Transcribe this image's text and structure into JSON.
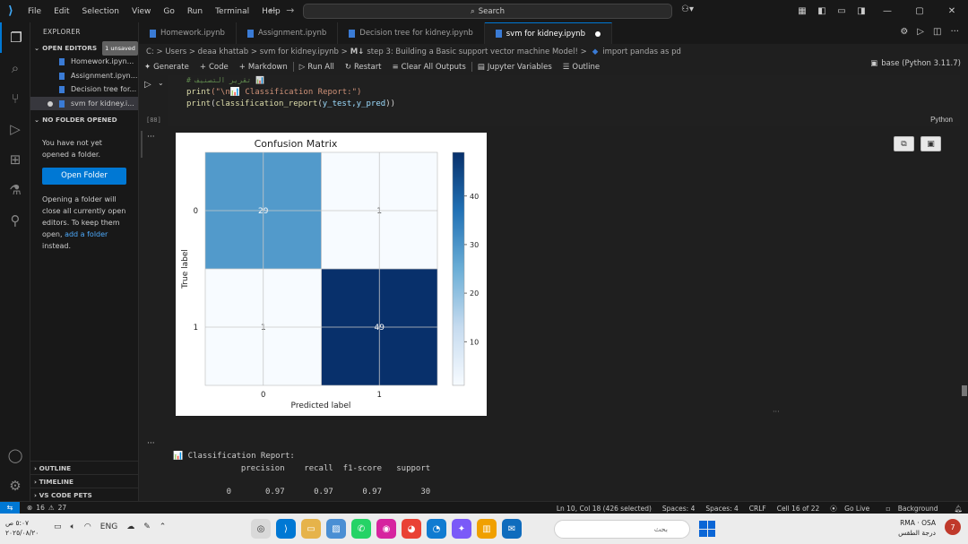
{
  "titlebar": {
    "menu": [
      "File",
      "Edit",
      "Selection",
      "View",
      "Go",
      "Run",
      "Terminal",
      "Help"
    ],
    "search_label": "Search"
  },
  "sidebar": {
    "title": "EXPLORER",
    "open_editors_label": "OPEN EDITORS",
    "unsaved_badge": "1 unsaved",
    "open_editors": [
      "Homework.ipyn...",
      "Assignment.ipyn...",
      "Decision tree for...",
      "svm for kidney.i..."
    ],
    "no_folder_label": "NO FOLDER OPENED",
    "no_folder_text": "You have not yet opened a folder.",
    "open_folder_button": "Open Folder",
    "close_text_1": "Opening a folder will close all currently open editors. To keep them open,",
    "add_folder_link": "add a folder",
    "close_text_2": "instead.",
    "bottom_sections": [
      "OUTLINE",
      "TIMELINE",
      "VS CODE PETS"
    ]
  },
  "tabs": [
    {
      "label": "Homework.ipynb",
      "active": false
    },
    {
      "label": "Assignment.ipynb",
      "active": false
    },
    {
      "label": "Decision tree for kidney.ipynb",
      "active": false
    },
    {
      "label": "svm for kidney.ipynb",
      "active": true
    }
  ],
  "breadcrumb": {
    "path": "C: > Users > deaa khattab > svm for kidney.ipynb >",
    "section": "step 3: Building a Basic support vector machine Model! >",
    "cell": "import pandas as pd"
  },
  "toolbar": {
    "generate": "Generate",
    "code": "Code",
    "markdown": "Markdown",
    "run_all": "Run All",
    "restart": "Restart",
    "clear_outputs": "Clear All Outputs",
    "jupyter_variables": "Jupyter Variables",
    "outline": "Outline",
    "kernel": "base (Python 3.11.7)"
  },
  "cell": {
    "code_comment": "# تقرير التصنيف 📊",
    "code_line_2_fn": "print",
    "code_line_2_str": "(\"\\n📊 Classification Report:\")",
    "code_line_3_fn": "print",
    "code_line_3_inner": "classification_report",
    "code_line_3_args": "y_test,y_pred",
    "exec_count": "[88]",
    "language": "Python"
  },
  "chart_data": {
    "type": "heatmap",
    "title": "Confusion Matrix",
    "xlabel": "Predicted label",
    "ylabel": "True label",
    "x_categories": [
      "0",
      "1"
    ],
    "y_categories": [
      "0",
      "1"
    ],
    "values": [
      [
        29,
        1
      ],
      [
        1,
        49
      ]
    ],
    "colorbar_ticks": [
      10,
      20,
      30,
      40
    ],
    "colorbar_range": [
      1,
      49
    ],
    "colormap": "Blues",
    "grid": true
  },
  "report": {
    "header": "📊 Classification Report:",
    "columns": "              precision    recall  f1-score   support",
    "row0": "           0       0.97      0.97      0.97        30"
  },
  "statusbar": {
    "errors": "16",
    "warnings": "27",
    "position": "Ln 10, Col 18 (426 selected)",
    "spaces4a": "Spaces: 4",
    "spaces4b": "Spaces: 4",
    "eol": "CRLF",
    "cell_info": "Cell 16 of 22",
    "go_live": "Go Live",
    "background": "Background"
  },
  "taskbar": {
    "time": "٥:٠٧ ص",
    "date": "٢٠٢٥/٠٨/٢٠",
    "lang": "ENG",
    "search_placeholder": "بحث",
    "market_1": "RMA",
    "market_2": "OSA",
    "weather_text": "درجة الطقس",
    "notif_count": "7"
  },
  "colors": {
    "accent": "#0078d4",
    "background": "#1f1f1f",
    "sidebar": "#181818"
  }
}
